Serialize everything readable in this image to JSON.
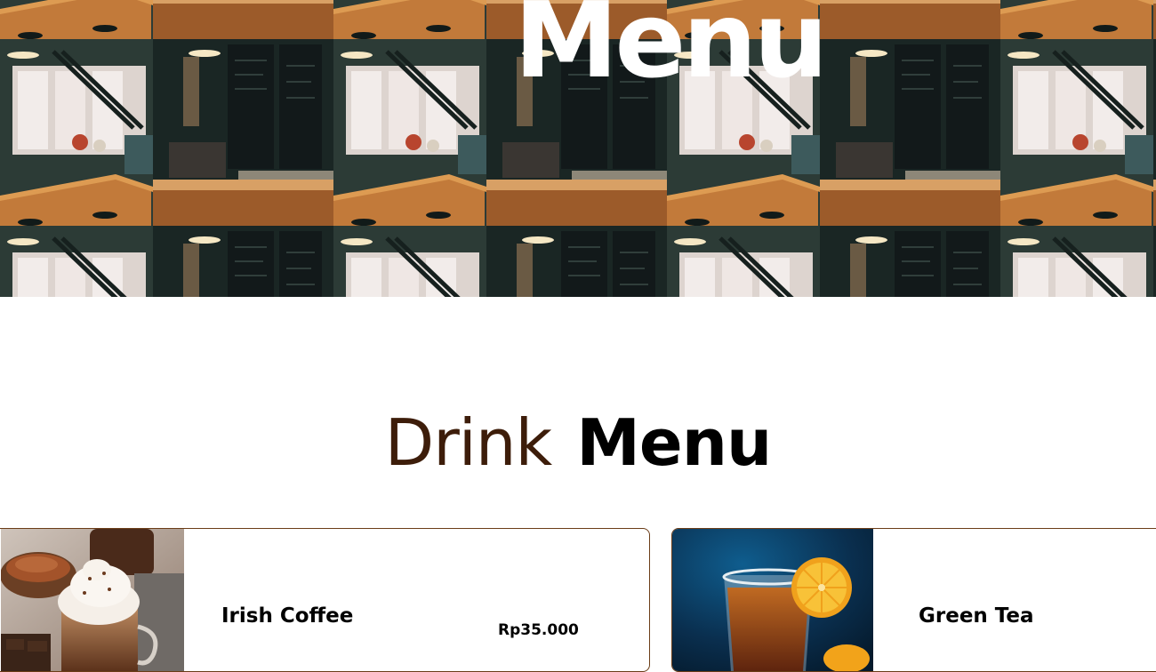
{
  "hero": {
    "title": "Menu",
    "background_image": "cafe-interior-photo-tiled"
  },
  "section": {
    "title_light": "Drink",
    "title_bold": "Menu",
    "colors": {
      "light_word": "#3d1d0a",
      "bold_word": "#000000",
      "card_border": "#6b3d18"
    }
  },
  "menu_items": [
    {
      "name": "Irish Coffee",
      "price": "Rp35.000",
      "image": "irish-coffee-with-whipped-cream-photo"
    },
    {
      "name": "Green Tea",
      "price": "",
      "image": "tea-with-lemon-slice-photo"
    }
  ]
}
